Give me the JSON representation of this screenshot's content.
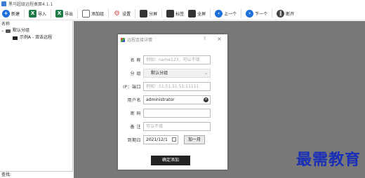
{
  "window": {
    "title": "黑马超级远程桌面4.1.1"
  },
  "toolbar": {
    "items": [
      {
        "label": "新建",
        "icon": "new-icon"
      },
      {
        "label": "导入",
        "icon": "excel-import-icon"
      },
      {
        "label": "导出",
        "icon": "excel-export-icon"
      },
      {
        "label": "添加组",
        "icon": "add-group-icon"
      },
      {
        "label": "设置",
        "icon": "gear-icon"
      },
      {
        "label": "分屏",
        "icon": "split-screen-icon"
      },
      {
        "label": "标签",
        "icon": "tab-icon"
      },
      {
        "label": "全屏",
        "icon": "fullscreen-icon"
      },
      {
        "label": "上一个",
        "icon": "prev-icon"
      },
      {
        "label": "下一个",
        "icon": "next-icon"
      },
      {
        "label": "断开",
        "icon": "disconnect-icon"
      }
    ]
  },
  "tree": {
    "column_header": "名称",
    "group": {
      "label": "默认分组"
    },
    "item": {
      "label": "示例A - 双击远程"
    }
  },
  "status_bar": {
    "label": "查找:"
  },
  "dialog": {
    "title": "远程连接详情",
    "help": "?",
    "close": "×",
    "name": {
      "label": "名 称",
      "placeholder": "例如：name123，可以不填"
    },
    "group": {
      "label": "分 组",
      "value": "默认分组"
    },
    "ip": {
      "label": "IP：端口",
      "placeholder": "例如：51.51.51.51:11111"
    },
    "user": {
      "label": "用户名",
      "value": "administrator"
    },
    "password": {
      "label": "密 码",
      "value": ""
    },
    "note": {
      "label": "备 注",
      "placeholder": "可以不填"
    },
    "expire": {
      "label": "到期日",
      "value": "2021/12/1",
      "add_month": "加一月"
    },
    "confirm": "确定添加"
  },
  "watermark": "最需教育"
}
